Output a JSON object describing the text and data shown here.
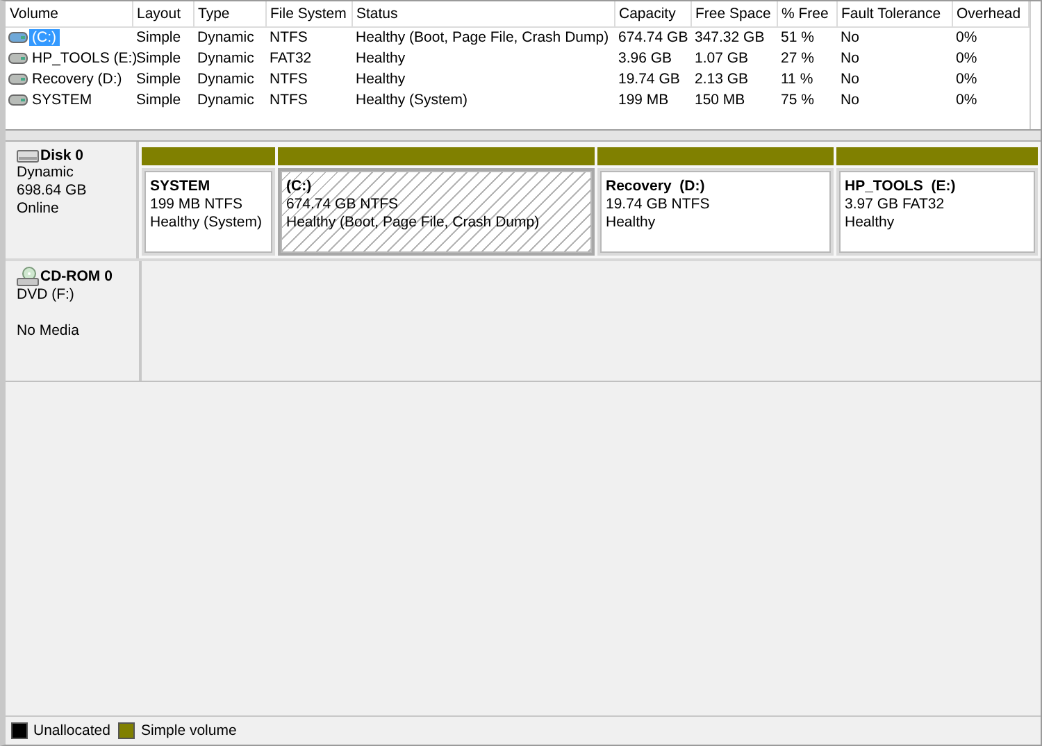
{
  "volume_list": {
    "columns": [
      "Volume",
      "Layout",
      "Type",
      "File System",
      "Status",
      "Capacity",
      "Free Space",
      "% Free",
      "Fault Tolerance",
      "Overhead"
    ],
    "rows": [
      {
        "cells": [
          "(C:)",
          "Simple",
          "Dynamic",
          "NTFS",
          "Healthy (Boot, Page File, Crash Dump)",
          "674.74 GB",
          "347.32 GB",
          "51 %",
          "No",
          "0%"
        ],
        "selected": true
      },
      {
        "cells": [
          "HP_TOOLS (E:)",
          "Simple",
          "Dynamic",
          "FAT32",
          "Healthy",
          "3.96 GB",
          "1.07 GB",
          "27 %",
          "No",
          "0%"
        ],
        "selected": false
      },
      {
        "cells": [
          "Recovery (D:)",
          "Simple",
          "Dynamic",
          "NTFS",
          "Healthy",
          "19.74 GB",
          "2.13 GB",
          "11 %",
          "No",
          "0%"
        ],
        "selected": false
      },
      {
        "cells": [
          "SYSTEM",
          "Simple",
          "Dynamic",
          "NTFS",
          "Healthy (System)",
          "199 MB",
          "150 MB",
          "75 %",
          "No",
          "0%"
        ],
        "selected": false
      }
    ]
  },
  "disks": [
    {
      "kind": "disk",
      "name": "Disk 0",
      "type": "Dynamic",
      "size": "698.64 GB",
      "status": "Online",
      "partitions": [
        {
          "name": "SYSTEM",
          "size": "199 MB NTFS",
          "status": "Healthy (System)",
          "color": "#808000",
          "selected": false
        },
        {
          "name": "(C:)",
          "size": "674.74 GB NTFS",
          "status": "Healthy (Boot, Page File, Crash Dump)",
          "color": "#808000",
          "selected": true
        },
        {
          "name": "Recovery  (D:)",
          "size": "19.74 GB NTFS",
          "status": "Healthy",
          "color": "#808000",
          "selected": false
        },
        {
          "name": "HP_TOOLS  (E:)",
          "size": "3.97 GB FAT32",
          "status": "Healthy",
          "color": "#808000",
          "selected": false
        }
      ]
    },
    {
      "kind": "cdrom",
      "name": "CD-ROM 0",
      "type": "DVD (F:)",
      "status": "No Media"
    }
  ],
  "legend": [
    {
      "label": "Unallocated",
      "color": "#000000"
    },
    {
      "label": "Simple volume",
      "color": "#808000"
    }
  ]
}
